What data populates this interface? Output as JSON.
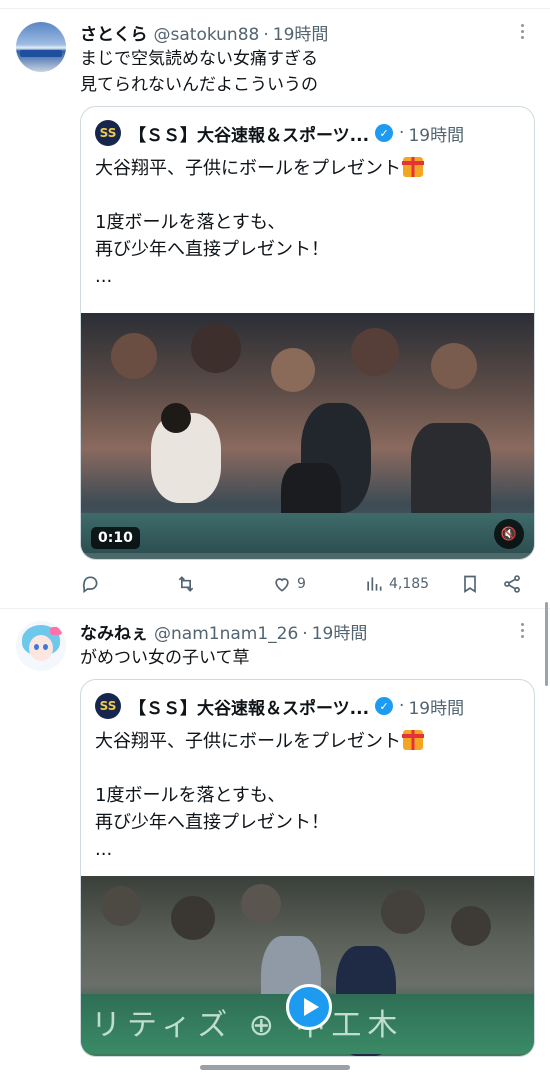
{
  "tweets": [
    {
      "display_name": "さとくら",
      "handle": "@satokun88",
      "separator": "·",
      "time": "19時間",
      "text": "まじで空気読めない女痛すぎる\n見てられないんだよこういうの",
      "quote": {
        "avatar_label": "SS",
        "name": "【ＳＳ】大谷速報＆スポーツ...",
        "separator": "·",
        "time": "19時間",
        "line1": "大谷翔平、子供にボールをプレゼント",
        "body": "1度ボールを落とすも、\n再び少年へ直接プレゼント！\n...",
        "media": {
          "duration": "0:10",
          "muted_icon": "volume-muted-icon"
        }
      },
      "actions": {
        "reply_count": "",
        "retweet_count": "",
        "like_count": "9",
        "view_count": "4,185"
      }
    },
    {
      "display_name": "なみねぇ",
      "handle": "@nam1nam1_26",
      "separator": "·",
      "time": "19時間",
      "text": "がめつい女の子いて草",
      "quote": {
        "avatar_label": "SS",
        "name": "【ＳＳ】大谷速報＆スポーツ...",
        "separator": "·",
        "time": "19時間",
        "line1": "大谷翔平、子供にボールをプレゼント",
        "body": "1度ボールを落とすも、\n再び少年へ直接プレゼント！\n...",
        "media": {
          "banner_text": "リティズ ⊕ 中工木",
          "play_icon": "play-icon"
        }
      }
    }
  ],
  "colors": {
    "text": "#0f1419",
    "secondary": "#536471",
    "verified": "#1d9bf0",
    "border": "#cfd9de"
  }
}
